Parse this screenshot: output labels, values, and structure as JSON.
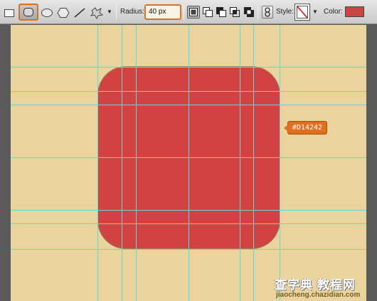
{
  "toolbar": {
    "shape_tools": [
      {
        "name": "rectangle-tool",
        "icon": "rectangle-icon",
        "selected": false
      },
      {
        "name": "rounded-rectangle-tool",
        "icon": "rounded-rectangle-icon",
        "selected": true
      },
      {
        "name": "ellipse-tool",
        "icon": "ellipse-icon",
        "selected": false
      },
      {
        "name": "polygon-tool",
        "icon": "polygon-icon",
        "selected": false
      },
      {
        "name": "line-tool",
        "icon": "line-icon",
        "selected": false
      },
      {
        "name": "custom-shape-tool",
        "icon": "custom-shape-icon",
        "selected": false
      }
    ],
    "radius_label": "Radius:",
    "radius_value": "40 px",
    "style_label": "Style:",
    "style_icon": "no-style-icon",
    "color_label": "Color:",
    "color_value": "#D14242",
    "accent_color": "#d9731f",
    "mode_icons": [
      "create-new-shape-layer-icon",
      "add-to-shape-area-icon",
      "subtract-from-shape-area-icon",
      "intersect-shape-areas-icon",
      "exclude-overlapping-shape-areas-icon"
    ],
    "link_icon": "link-icon"
  },
  "canvas": {
    "background_color": "#e8d49c",
    "shape_fill": "#d14242",
    "guide_color": "#55e0dc",
    "color_tag_text": "#D14242"
  },
  "watermark": {
    "main_text": "查字典 教程网",
    "sub_text": "jiaocheng.chazidian.com"
  }
}
